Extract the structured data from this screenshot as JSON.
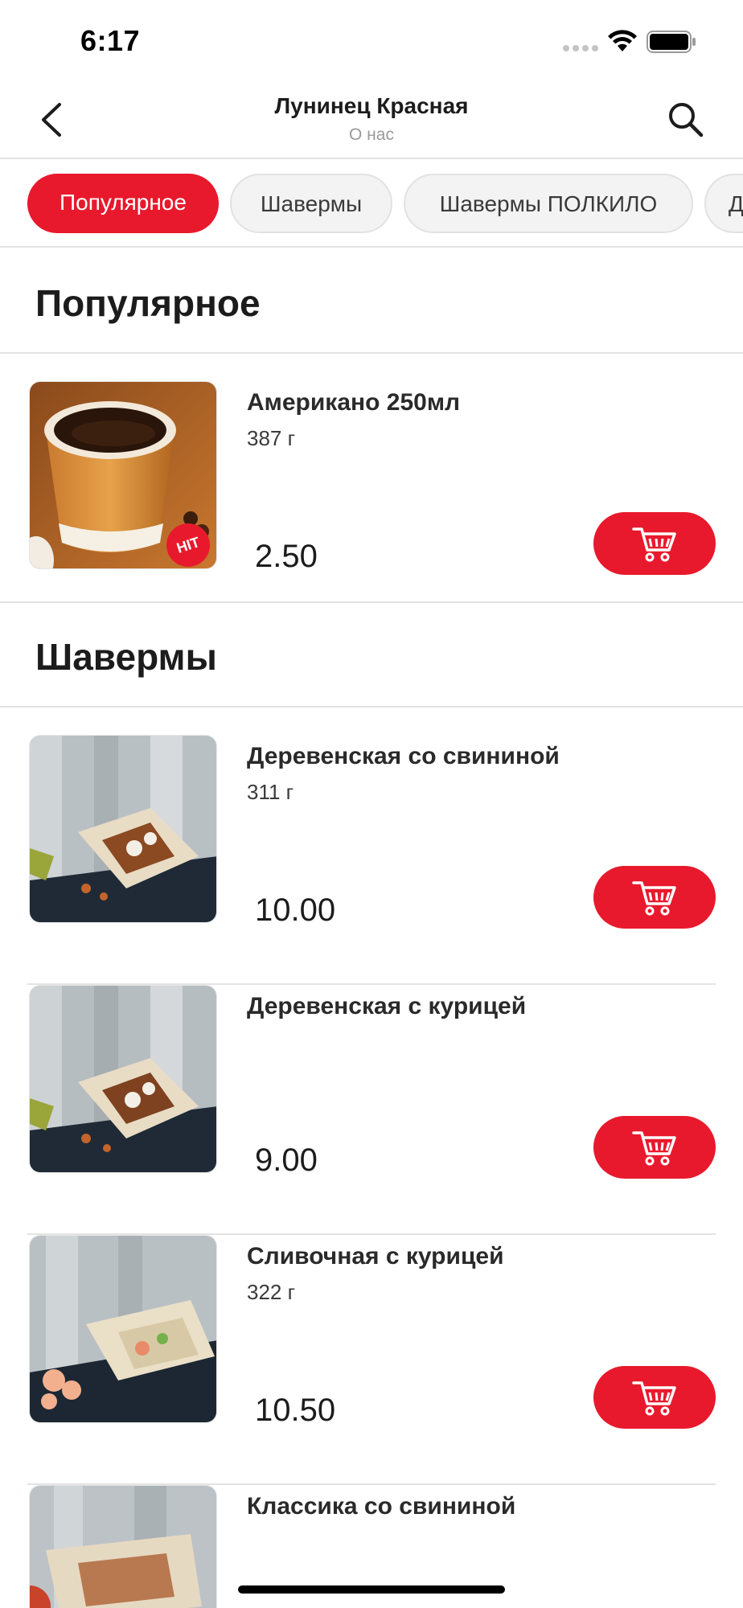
{
  "status_bar": {
    "time": "6:17"
  },
  "nav": {
    "title": "Лунинец Красная",
    "subtitle": "О нас"
  },
  "categories": [
    {
      "label": "Популярное",
      "active": true
    },
    {
      "label": "Шавермы",
      "active": false
    },
    {
      "label": "Шавермы ПОЛКИЛО",
      "active": false
    },
    {
      "label": "Д",
      "active": false
    }
  ],
  "sections": [
    {
      "title": "Популярное",
      "products": [
        {
          "name": "Американо 250мл",
          "weight": "387 г",
          "price": "2.50",
          "badge": "HIT",
          "image": "coffee-cup"
        }
      ]
    },
    {
      "title": "Шавермы",
      "products": [
        {
          "name": "Деревенская со свининой",
          "weight": "311 г",
          "price": "10.00",
          "image": "shawarma"
        },
        {
          "name": "Деревенская с курицей",
          "weight": "",
          "price": "9.00",
          "image": "shawarma"
        },
        {
          "name": "Сливочная с курицей",
          "weight": "322 г",
          "price": "10.50",
          "image": "shawarma-shrimp"
        },
        {
          "name": "Классика со свининой",
          "weight": "",
          "price": "",
          "image": "shawarma-classic"
        }
      ]
    }
  ],
  "colors": {
    "accent": "#e8192c",
    "divider": "#e3e3e3",
    "chip_bg": "#f3f3f3"
  },
  "icons": {
    "back": "chevron-left-icon",
    "search": "search-icon",
    "cart": "cart-icon"
  }
}
